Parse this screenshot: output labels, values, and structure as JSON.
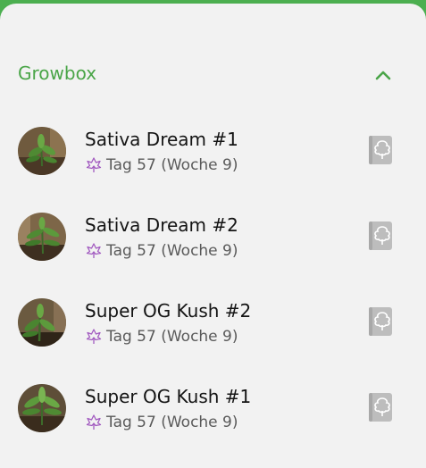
{
  "section": {
    "title": "Growbox"
  },
  "plants": [
    {
      "name": "Sativa Dream #1",
      "age": "Tag 57 (Woche 9)"
    },
    {
      "name": "Sativa Dream #2",
      "age": "Tag 57 (Woche 9)"
    },
    {
      "name": "Super OG Kush #2",
      "age": "Tag 57 (Woche 9)"
    },
    {
      "name": "Super OG Kush #1",
      "age": "Tag 57 (Woche 9)"
    }
  ],
  "icons": {
    "collapse": "chevron-up-icon",
    "stage": "cannabis-leaf-icon",
    "diary": "plant-diary-icon"
  },
  "colors": {
    "accent": "#4aa548",
    "stage_icon": "#a25bc0",
    "diary_icon": "#bdbdbd"
  }
}
